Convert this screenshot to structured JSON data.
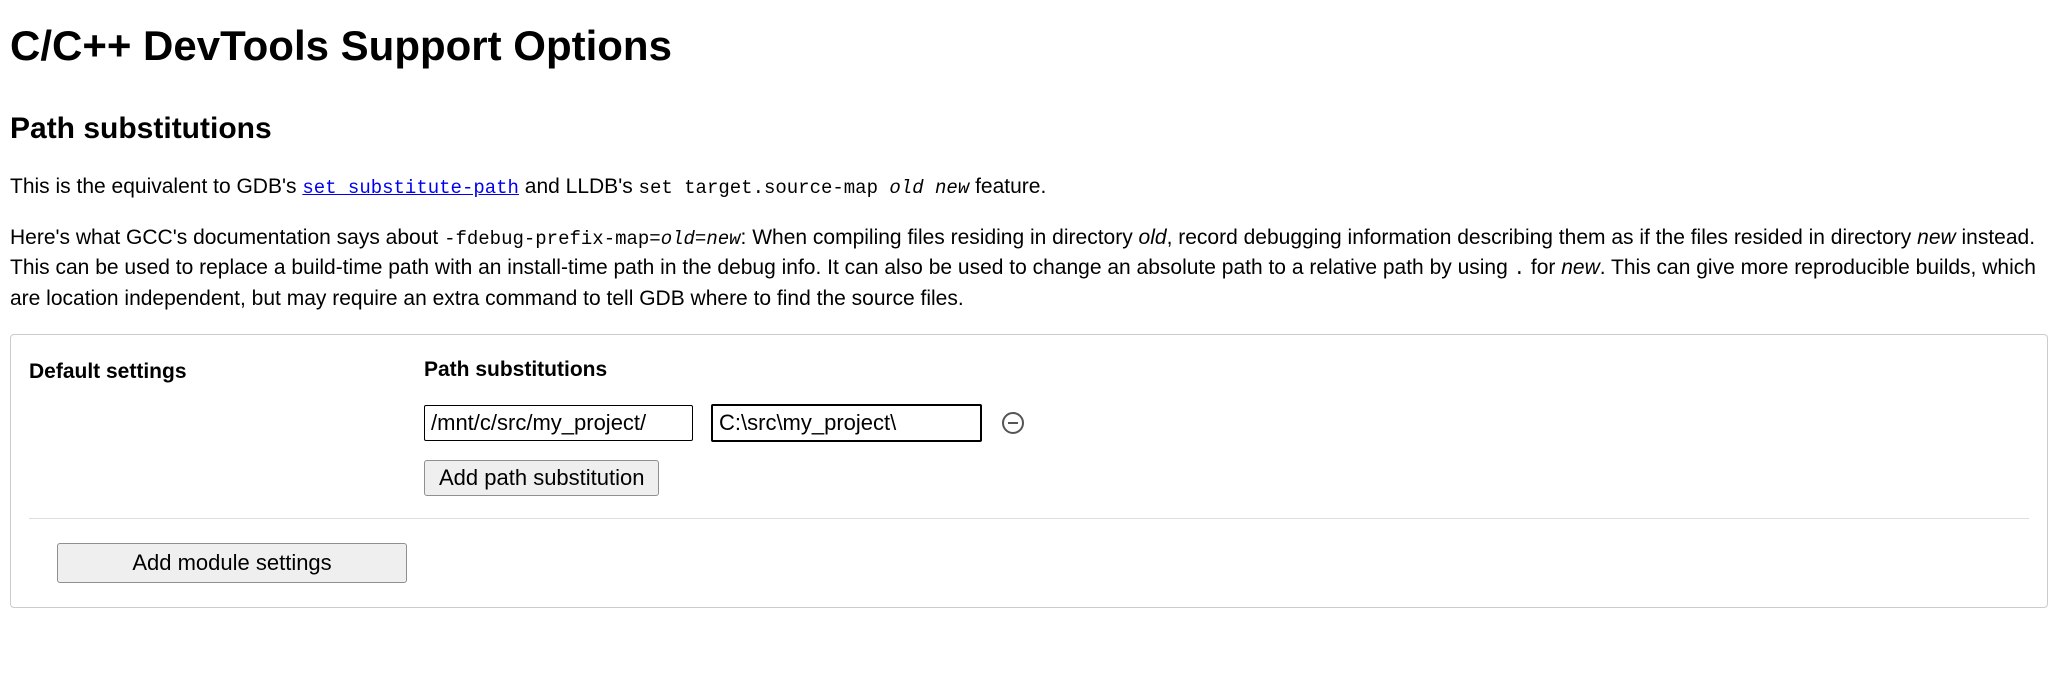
{
  "title": "C/C++ DevTools Support Options",
  "section_title": "Path substitutions",
  "para1": {
    "t1": "This is the equivalent to GDB's ",
    "link_text": "set substitute-path",
    "t2": " and LLDB's ",
    "code2": "set target.source-map ",
    "it_old": "old",
    "sp": " ",
    "it_new": "new",
    "t3": " feature."
  },
  "para2": {
    "t1": "Here's what GCC's documentation says about ",
    "code1": "-fdebug-prefix-map=",
    "it_old": "old",
    "eq": "=",
    "it_new": "new",
    "t2": ": When compiling files residing in directory ",
    "it_old2": "old",
    "t3": ", record debugging information describing them as if the files resided in directory ",
    "it_new2": "new",
    "t4": " instead. This can be used to replace a build-time path with an install-time path in the debug info. It can also be used to change an absolute path to a relative path by using ",
    "dot": ".",
    "t5": " for ",
    "it_new3": "new",
    "t6": ". This can give more reproducible builds, which are location independent, but may require an extra command to tell GDB where to find the source files."
  },
  "box": {
    "left_label": "Default settings",
    "right_label": "Path substitutions",
    "from_value": "/mnt/c/src/my_project/",
    "to_value": "C:\\src\\my_project\\",
    "add_path_label": "Add path substitution",
    "add_module_label": "Add module settings"
  }
}
